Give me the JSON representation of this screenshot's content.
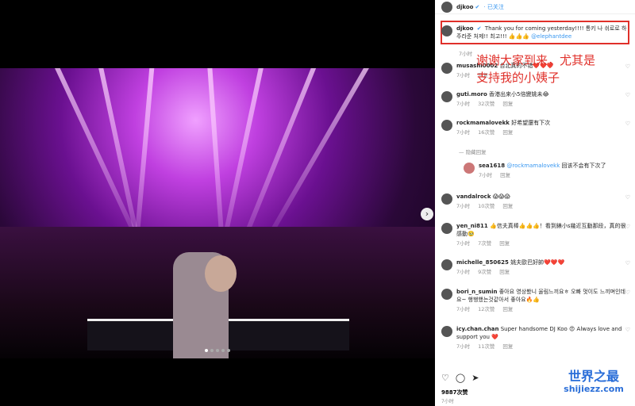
{
  "post": {
    "username": "djkoo",
    "follow_label": "· 已关注"
  },
  "caption": {
    "username": "djkoo",
    "text": "Thank you for coming yesterday!!!! 통키 나 쉬로로 하주라준 처제!! 최고!!! 👍👍👍",
    "mention": "@elephantdee",
    "time": "7小时"
  },
  "annotation": {
    "line1": "谢谢大家到来，尤其是",
    "line2": "支持我的小姨子"
  },
  "comments": [
    {
      "user": "musashi0002",
      "text": "台北真的不错❤️❤️❤️",
      "time": "7小时",
      "likes": "",
      "reply": "回复"
    },
    {
      "user": "guti.moro",
      "text": "香港出来小5倍變姚未😂",
      "time": "7小时",
      "likes": "32次赞",
      "reply": "回复"
    },
    {
      "user": "rockmamalovekk",
      "text": "好希望還有下次",
      "time": "7小时",
      "likes": "16次赞",
      "reply": "回复"
    },
    {
      "user": "vandalrock",
      "text": "😱😱😱",
      "time": "7小时",
      "likes": "10次赞",
      "reply": "回复"
    },
    {
      "user": "yen_ni811",
      "text": "👍信夫真棒👍👍👍！看到錶小s幾近互動那段，真的很感動🥹",
      "time": "7小时",
      "likes": "7次赞",
      "reply": "回复"
    },
    {
      "user": "michelle_850625",
      "text": "姚夫歐巴好帥❤️❤️❤️",
      "time": "7小时",
      "likes": "9次赞",
      "reply": "回复"
    },
    {
      "user": "bori_n_sumin",
      "text": "좋아요 영상봤니 울림느끼요ㅎ 오빠 멋이도 느끼며인데요~ 행행했는것같아서 좋아요🔥👍",
      "time": "7小时",
      "likes": "12次赞",
      "reply": "回复"
    },
    {
      "user": "icy.chan.chan",
      "text": "Super handsome DJ Koo 😍 Always love and support you ❤️",
      "time": "7小时",
      "likes": "11次赞",
      "reply": "回复"
    }
  ],
  "reply": {
    "hidden_label": "隐藏回复",
    "time": "7小时",
    "reply_label": "回复",
    "user": "sea1618",
    "mention": "@rockmamalovekk",
    "text": "回该不会有下次了"
  },
  "footer": {
    "likes": "9887次赞",
    "time": "7小时"
  },
  "watermark": {
    "line1": "世界之最",
    "line2": "shijiezz.com"
  }
}
